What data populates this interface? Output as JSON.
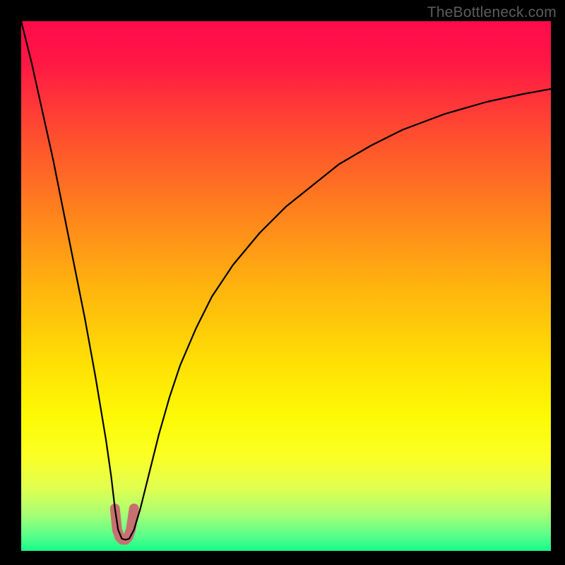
{
  "watermark": "TheBottleneck.com",
  "chart_data": {
    "type": "line",
    "title": "",
    "xlabel": "",
    "ylabel": "",
    "xlim": [
      0,
      100
    ],
    "ylim": [
      0,
      100
    ],
    "background_gradient": {
      "stops": [
        {
          "offset": 0.0,
          "color": "#ff0b4b"
        },
        {
          "offset": 0.08,
          "color": "#ff1844"
        },
        {
          "offset": 0.2,
          "color": "#ff4831"
        },
        {
          "offset": 0.35,
          "color": "#ff7e1e"
        },
        {
          "offset": 0.5,
          "color": "#ffb30e"
        },
        {
          "offset": 0.65,
          "color": "#ffe104"
        },
        {
          "offset": 0.75,
          "color": "#fdfa06"
        },
        {
          "offset": 0.82,
          "color": "#fbff24"
        },
        {
          "offset": 0.88,
          "color": "#e2ff4f"
        },
        {
          "offset": 0.93,
          "color": "#a9ff73"
        },
        {
          "offset": 0.97,
          "color": "#5cff8b"
        },
        {
          "offset": 1.0,
          "color": "#17fb89"
        }
      ]
    },
    "series": [
      {
        "name": "curve",
        "color": "#000000",
        "width": 2.2,
        "x": [
          0,
          2,
          4,
          6,
          8,
          10,
          12,
          14,
          16,
          17,
          17.7,
          18.3,
          19,
          19.7,
          20.4,
          21.3,
          22.5,
          24,
          26,
          28,
          30,
          33,
          36,
          40,
          45,
          50,
          55,
          60,
          66,
          72,
          80,
          88,
          95,
          100
        ],
        "y": [
          100,
          92,
          83,
          74,
          64,
          54,
          44,
          33,
          21,
          14,
          8,
          4,
          2.3,
          2.1,
          2.3,
          4,
          8,
          14,
          22,
          29,
          35,
          42,
          48,
          54,
          60,
          65,
          69,
          73,
          76.5,
          79.5,
          82.5,
          84.8,
          86.3,
          87.2
        ]
      }
    ],
    "marker": {
      "shape": "u",
      "color": "#c77070",
      "stroke_width": 14,
      "points": [
        {
          "x": 17.7,
          "y": 8.0
        },
        {
          "x": 18.1,
          "y": 4.0
        },
        {
          "x": 18.6,
          "y": 2.6
        },
        {
          "x": 19.1,
          "y": 2.1
        },
        {
          "x": 19.7,
          "y": 2.1
        },
        {
          "x": 20.2,
          "y": 2.6
        },
        {
          "x": 20.7,
          "y": 4.0
        },
        {
          "x": 21.3,
          "y": 8.0
        }
      ]
    }
  }
}
